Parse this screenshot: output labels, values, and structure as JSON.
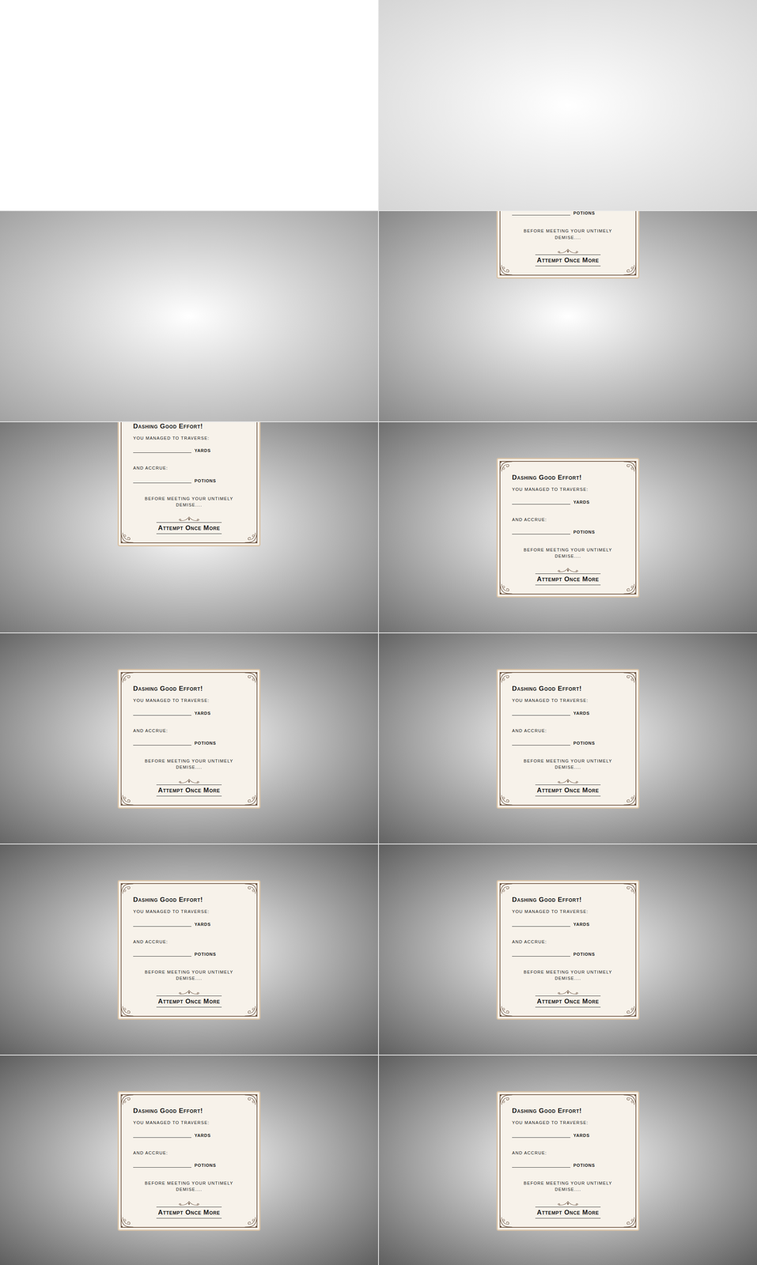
{
  "frames": [
    {
      "fade": 0,
      "card": null
    },
    {
      "fade": 0.25,
      "card": null
    },
    {
      "fade": 0.55,
      "card": null
    },
    {
      "fade": 0.7,
      "card": {
        "cut": true,
        "items": [
          {
            "kind": "field",
            "text": "POTIONS"
          },
          {
            "kind": "note",
            "text": "BEFORE MEETING YOUR UNTIMELY DEMISE...."
          },
          {
            "kind": "button",
            "text": "Attempt Once More"
          }
        ]
      }
    },
    {
      "fade": 0.8,
      "card": {
        "cut": true,
        "items": [
          {
            "kind": "title",
            "text": "Dashing Good Effort!"
          },
          {
            "kind": "label",
            "text": "YOU MANAGED TO TRAVERSE:"
          },
          {
            "kind": "field",
            "text": "YARDS"
          },
          {
            "kind": "label",
            "text": "AND ACCRUE:"
          },
          {
            "kind": "field",
            "text": "POTIONS"
          },
          {
            "kind": "note",
            "text": "BEFORE MEETING YOUR UNTIMELY DEMISE...."
          },
          {
            "kind": "button",
            "text": "Attempt Once More"
          }
        ]
      }
    },
    {
      "fade": 0.85,
      "card": {
        "cut": false,
        "items": [
          {
            "kind": "title",
            "text": "Dashing Good Effort!"
          },
          {
            "kind": "label",
            "text": "YOU MANAGED TO TRAVERSE:"
          },
          {
            "kind": "field",
            "text": "YARDS"
          },
          {
            "kind": "label",
            "text": "AND ACCRUE:"
          },
          {
            "kind": "field",
            "text": "POTIONS"
          },
          {
            "kind": "note",
            "text": "BEFORE MEETING YOUR UNTIMELY DEMISE...."
          },
          {
            "kind": "button",
            "text": "Attempt Once More"
          }
        ]
      }
    },
    {
      "fade": 0.9,
      "card": {
        "cut": false,
        "items": [
          {
            "kind": "title",
            "text": "Dashing Good Effort!"
          },
          {
            "kind": "label",
            "text": "YOU MANAGED TO TRAVERSE:"
          },
          {
            "kind": "field",
            "text": "YARDS"
          },
          {
            "kind": "label",
            "text": "AND ACCRUE:"
          },
          {
            "kind": "field",
            "text": "POTIONS"
          },
          {
            "kind": "note",
            "text": "BEFORE MEETING YOUR UNTIMELY DEMISE...."
          },
          {
            "kind": "button",
            "text": "Attempt Once More"
          }
        ]
      }
    },
    {
      "fade": 0.92,
      "card": {
        "cut": false,
        "items": [
          {
            "kind": "title",
            "text": "Dashing Good Effort!"
          },
          {
            "kind": "label",
            "text": "YOU MANAGED TO TRAVERSE:"
          },
          {
            "kind": "field",
            "text": "YARDS"
          },
          {
            "kind": "label",
            "text": "AND ACCRUE:"
          },
          {
            "kind": "field",
            "text": "POTIONS"
          },
          {
            "kind": "note",
            "text": "BEFORE MEETING YOUR UNTIMELY DEMISE...."
          },
          {
            "kind": "button",
            "text": "Attempt Once More"
          }
        ]
      }
    },
    {
      "fade": 0.93,
      "card": {
        "cut": false,
        "items": [
          {
            "kind": "title",
            "text": "Dashing Good Effort!"
          },
          {
            "kind": "label",
            "text": "YOU MANAGED TO TRAVERSE:"
          },
          {
            "kind": "field",
            "text": "YARDS"
          },
          {
            "kind": "label",
            "text": "AND ACCRUE:"
          },
          {
            "kind": "field",
            "text": "POTIONS"
          },
          {
            "kind": "note",
            "text": "BEFORE MEETING YOUR UNTIMELY DEMISE...."
          },
          {
            "kind": "button",
            "text": "Attempt Once More"
          }
        ]
      }
    },
    {
      "fade": 0.94,
      "card": {
        "cut": false,
        "items": [
          {
            "kind": "title",
            "text": "Dashing Good Effort!"
          },
          {
            "kind": "label",
            "text": "YOU MANAGED TO TRAVERSE:"
          },
          {
            "kind": "field",
            "text": "YARDS"
          },
          {
            "kind": "label",
            "text": "AND ACCRUE:"
          },
          {
            "kind": "field",
            "text": "POTIONS"
          },
          {
            "kind": "note",
            "text": "BEFORE MEETING YOUR UNTIMELY DEMISE...."
          },
          {
            "kind": "button",
            "text": "Attempt Once More"
          }
        ]
      }
    },
    {
      "fade": 0.95,
      "card": {
        "cut": false,
        "items": [
          {
            "kind": "title",
            "text": "Dashing Good Effort!"
          },
          {
            "kind": "label",
            "text": "YOU MANAGED TO TRAVERSE:"
          },
          {
            "kind": "field",
            "text": "YARDS"
          },
          {
            "kind": "label",
            "text": "AND ACCRUE:"
          },
          {
            "kind": "field",
            "text": "POTIONS"
          },
          {
            "kind": "note",
            "text": "BEFORE MEETING YOUR UNTIMELY DEMISE...."
          },
          {
            "kind": "button",
            "text": "Attempt Once More"
          }
        ]
      }
    },
    {
      "fade": 0.95,
      "card": {
        "cut": false,
        "items": [
          {
            "kind": "title",
            "text": "Dashing Good Effort!"
          },
          {
            "kind": "label",
            "text": "YOU MANAGED TO TRAVERSE:"
          },
          {
            "kind": "field",
            "text": "YARDS"
          },
          {
            "kind": "label",
            "text": "AND ACCRUE:"
          },
          {
            "kind": "field",
            "text": "POTIONS"
          },
          {
            "kind": "note",
            "text": "BEFORE MEETING YOUR UNTIMELY DEMISE...."
          },
          {
            "kind": "button",
            "text": "Attempt Once More"
          }
        ]
      }
    }
  ]
}
